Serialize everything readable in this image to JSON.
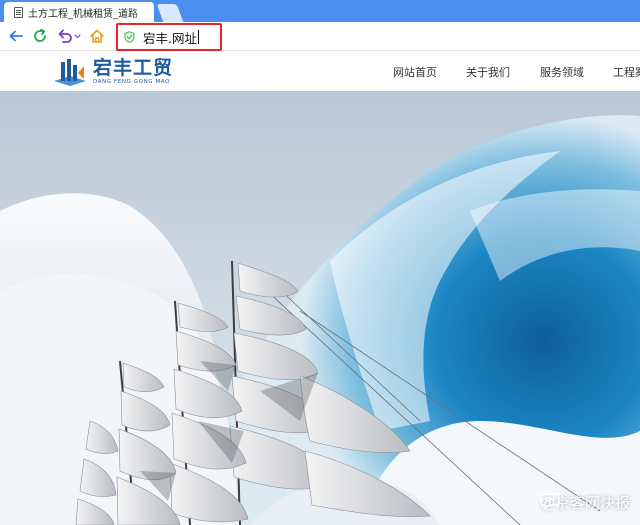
{
  "browser": {
    "tab_title": "土方工程_机械租赁_道路",
    "address_text": "宕丰.网址"
  },
  "site": {
    "logo_name": "宕丰工贸",
    "logo_sub": "DANG FENG GONG MAO",
    "nav": [
      {
        "label": "网站首页"
      },
      {
        "label": "关于我们"
      },
      {
        "label": "服务领域"
      },
      {
        "label": "工程案"
      }
    ]
  },
  "watermark": {
    "text": "@京客网快报"
  },
  "colors": {
    "tab_strip": "#4a8ff0",
    "address_highlight": "#e8242a",
    "brand": "#1d5a9e",
    "nav_back": "#2f7de1",
    "nav_refresh": "#1fae4c",
    "nav_undo": "#7a3fc4",
    "nav_home": "#f0a020"
  },
  "icons": {
    "tab": "document-icon",
    "back": "arrow-left-icon",
    "refresh": "refresh-icon",
    "undo": "undo-icon",
    "home": "home-icon",
    "security": "shield-check-icon",
    "watermark": "chat-bubble-icon"
  }
}
